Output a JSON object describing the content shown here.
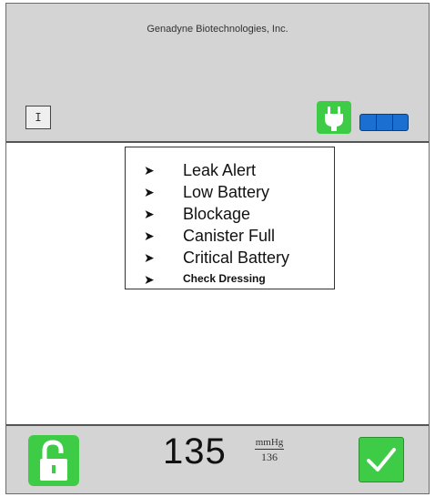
{
  "header": {
    "company": "Genadyne Biotechnologies, Inc.",
    "mode_indicator": "I",
    "power_icon": "plug-icon",
    "battery_icon": "battery-icon",
    "battery_level": 1.0
  },
  "alerts": [
    {
      "label": "Leak Alert"
    },
    {
      "label": "Low Battery"
    },
    {
      "label": "Blockage"
    },
    {
      "label": "Canister Full"
    },
    {
      "label": "Critical Battery"
    },
    {
      "label": "Check Dressing"
    }
  ],
  "footer": {
    "pressure_value": "135",
    "pressure_unit": "mmHg",
    "setpoint": "136",
    "lock_icon": "unlocked-padlock-icon",
    "confirm_icon": "checkmark-icon"
  },
  "colors": {
    "accent_green": "#3ecb45",
    "battery_blue": "#1a6fd0",
    "panel_gray": "#d4d4d4"
  }
}
